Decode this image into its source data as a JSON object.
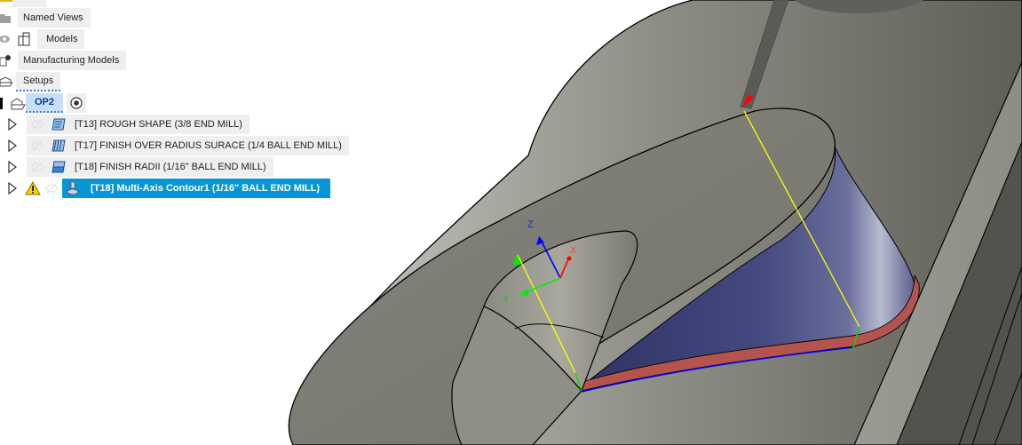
{
  "browser": {
    "items": [
      {
        "label": "Named Views",
        "icon": "folder-icon"
      },
      {
        "label": "Models",
        "icon": "model-icon",
        "visibility": "eye-icon"
      },
      {
        "label": "Manufacturing Models",
        "icon": "manufacturing-model-icon"
      },
      {
        "label": "Setups",
        "icon": "setup-icon"
      },
      {
        "label": "OP2",
        "icon": "setup-icon",
        "active_marker": "radio-active-icon"
      }
    ],
    "operations": [
      {
        "label": "[T13] ROUGH SHAPE (3/8 END MILL)",
        "icon": "adaptive-clearing-icon",
        "selected": false,
        "warning": false
      },
      {
        "label": "[T17] FINISH OVER RADIUS SURACE (1/4 BALL END MILL)",
        "icon": "scallop-icon",
        "selected": false,
        "warning": false
      },
      {
        "label": "[T18] FINISH RADII (1/16\" BALL END MILL)",
        "icon": "parallel-icon",
        "selected": false,
        "warning": false
      },
      {
        "label": "[T18] Multi-Axis Contour1 (1/16\" BALL END MILL)",
        "icon": "multi-axis-contour-icon",
        "selected": true,
        "warning": true
      }
    ]
  },
  "triad": {
    "x_label": "X",
    "y_label": "Y",
    "z_label": "Z"
  },
  "colors": {
    "selection": "#0696d7",
    "body_gray": "#7e7e76",
    "surface_blue": "#3a3d72",
    "toolpath_red": "#b5544e",
    "tool_axis_yellow": "#ffff00",
    "axis_x": "#ff0000",
    "axis_y": "#00ee00",
    "axis_z": "#0000ff"
  }
}
